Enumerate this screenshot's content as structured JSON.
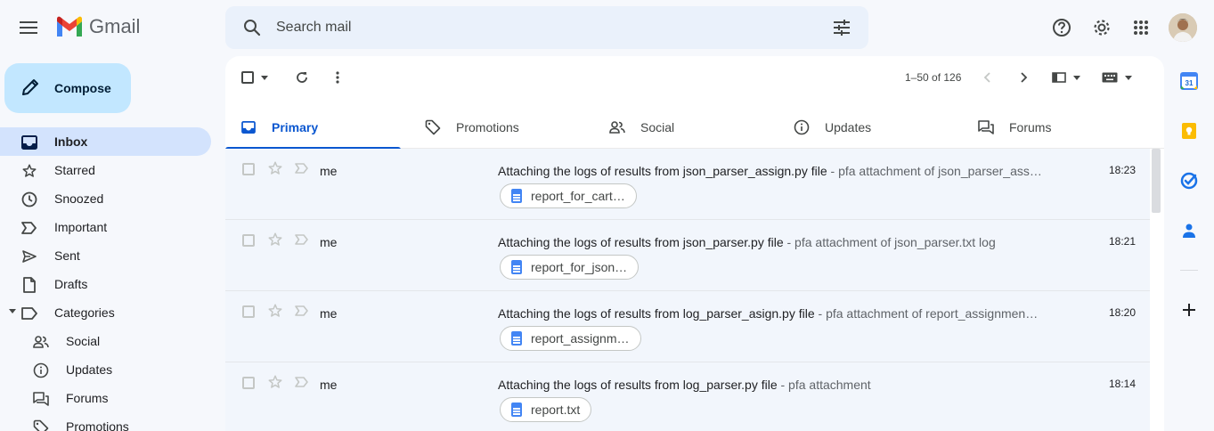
{
  "app": {
    "name": "Gmail",
    "brand_colors": {
      "red": "#ea4335",
      "blue": "#4285f4",
      "green": "#34a853",
      "yellow": "#fbbc04"
    }
  },
  "search": {
    "placeholder": "Search mail"
  },
  "compose": {
    "label": "Compose"
  },
  "sidebar": {
    "items": [
      {
        "label": "Inbox",
        "icon": "inbox-icon",
        "active": true
      },
      {
        "label": "Starred",
        "icon": "star-icon"
      },
      {
        "label": "Snoozed",
        "icon": "clock-icon"
      },
      {
        "label": "Important",
        "icon": "important-icon"
      },
      {
        "label": "Sent",
        "icon": "send-icon"
      },
      {
        "label": "Drafts",
        "icon": "draft-icon"
      },
      {
        "label": "Categories",
        "icon": "label-icon"
      }
    ],
    "categories": [
      {
        "label": "Social",
        "icon": "people-icon"
      },
      {
        "label": "Updates",
        "icon": "info-icon"
      },
      {
        "label": "Forums",
        "icon": "forum-icon"
      },
      {
        "label": "Promotions",
        "icon": "tag-icon"
      }
    ]
  },
  "toolbar": {
    "pagination": "1–50 of 126"
  },
  "tabs": [
    {
      "label": "Primary",
      "icon": "inbox-icon",
      "active": true
    },
    {
      "label": "Promotions",
      "icon": "tag-icon"
    },
    {
      "label": "Social",
      "icon": "people-icon"
    },
    {
      "label": "Updates",
      "icon": "info-icon"
    },
    {
      "label": "Forums",
      "icon": "forum-icon"
    }
  ],
  "emails": [
    {
      "sender": "me",
      "subject": "Attaching the logs of results from json_parser_assign.py file",
      "snippet": " - pfa attachment of json_parser_ass…",
      "time": "18:23",
      "attachment": "report_for_cart…"
    },
    {
      "sender": "me",
      "subject": "Attaching the logs of results from json_parser.py file",
      "snippet": " - pfa attachment of json_parser.txt log",
      "time": "18:21",
      "attachment": "report_for_json…"
    },
    {
      "sender": "me",
      "subject": "Attaching the logs of results from log_parser_asign.py file",
      "snippet": " - pfa attachment of report_assignmen…",
      "time": "18:20",
      "attachment": "report_assignm…"
    },
    {
      "sender": "me",
      "subject": "Attaching the logs of results from log_parser.py file",
      "snippet": " - pfa attachment",
      "time": "18:14",
      "attachment": "report.txt"
    }
  ],
  "side_panel": {
    "icons": [
      "calendar-icon",
      "keep-icon",
      "tasks-icon",
      "contacts-icon",
      "add-icon"
    ],
    "calendar_day": "31"
  }
}
